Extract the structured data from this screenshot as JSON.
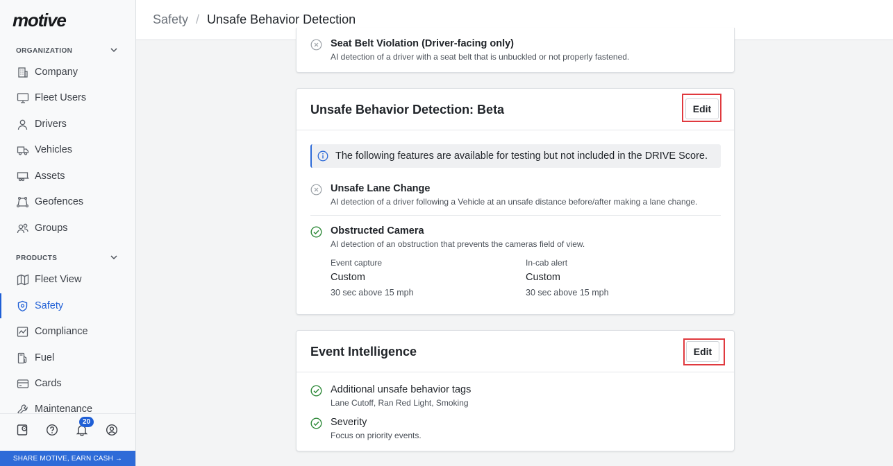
{
  "brand": {
    "logo": "motive"
  },
  "breadcrumb": {
    "parent": "Safety",
    "separator": "/",
    "current": "Unsafe Behavior Detection"
  },
  "sidebar": {
    "sections": [
      {
        "label": "ORGANIZATION",
        "items": [
          {
            "label": "Company",
            "icon": "building-icon"
          },
          {
            "label": "Fleet Users",
            "icon": "monitor-icon"
          },
          {
            "label": "Drivers",
            "icon": "person-icon"
          },
          {
            "label": "Vehicles",
            "icon": "truck-icon"
          },
          {
            "label": "Assets",
            "icon": "trailer-icon"
          },
          {
            "label": "Geofences",
            "icon": "geofence-icon"
          },
          {
            "label": "Groups",
            "icon": "groups-icon"
          }
        ]
      },
      {
        "label": "PRODUCTS",
        "items": [
          {
            "label": "Fleet View",
            "icon": "map-icon"
          },
          {
            "label": "Safety",
            "icon": "shield-icon",
            "active": true
          },
          {
            "label": "Compliance",
            "icon": "compliance-icon"
          },
          {
            "label": "Fuel",
            "icon": "fuel-icon"
          },
          {
            "label": "Cards",
            "icon": "card-icon"
          },
          {
            "label": "Maintenance",
            "icon": "wrench-icon"
          }
        ]
      }
    ],
    "notifications_count": "20",
    "share_label": "SHARE MOTIVE, EARN CASH →"
  },
  "cards": {
    "seatbelt": {
      "title": "Seat Belt Violation (Driver-facing only)",
      "desc": "AI detection of a driver with a seat belt that is unbuckled or not properly fastened.",
      "enabled": false
    },
    "beta": {
      "title": "Unsafe Behavior Detection: Beta",
      "edit_label": "Edit",
      "info": "The following features are available for testing but not included in the DRIVE Score.",
      "features": [
        {
          "title": "Unsafe Lane Change",
          "desc": "AI detection of a driver following a Vehicle at an unsafe distance before/after making a lane change.",
          "enabled": false
        },
        {
          "title": "Obstructed Camera",
          "desc": "AI detection of an obstruction that prevents the cameras field of view.",
          "enabled": true
        }
      ],
      "settings": [
        {
          "label": "Event capture",
          "value": "Custom",
          "detail": "30 sec above 15 mph"
        },
        {
          "label": "In-cab alert",
          "value": "Custom",
          "detail": "30 sec above 15 mph"
        }
      ]
    },
    "intel": {
      "title": "Event Intelligence",
      "edit_label": "Edit",
      "features": [
        {
          "title": "Additional unsafe behavior tags",
          "desc": "Lane Cutoff, Ran Red Light, Smoking",
          "enabled": true
        },
        {
          "title": "Severity",
          "desc": "Focus on priority events.",
          "enabled": true
        }
      ]
    }
  },
  "colors": {
    "accent": "#1f5fd6",
    "enabled": "#2f8a3a",
    "disabled": "#9aa0a6",
    "highlight": "#e0393e"
  }
}
